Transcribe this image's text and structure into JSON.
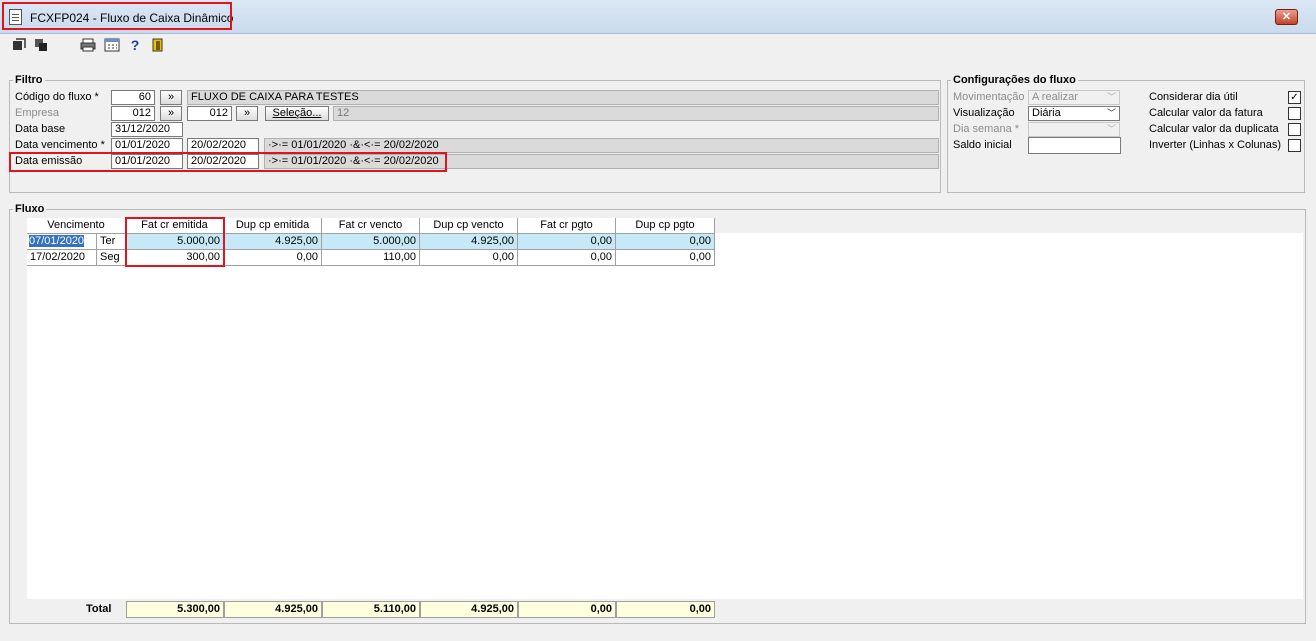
{
  "window": {
    "title": "FCXFP024 - Fluxo de Caixa Dinâmico",
    "close_label": "✕"
  },
  "toolbar": {
    "icons": [
      "arrow-in-icon",
      "copy-icon",
      "print-icon",
      "calculator-icon",
      "help-icon",
      "exit-icon"
    ]
  },
  "filtro": {
    "title": "Filtro",
    "codigo_label": "Código do fluxo *",
    "codigo_value": "60",
    "codigo_desc": "FLUXO DE CAIXA PARA TESTES",
    "empresa_label": "Empresa",
    "empresa_value": "012",
    "empresa_value2": "012",
    "selecao_label": "Seleção...",
    "selecao_count": "12",
    "lookup_label": "»",
    "data_base_label": "Data base",
    "data_base_value": "31/12/2020",
    "data_venc_label": "Data vencimento *",
    "data_venc_from": "01/01/2020",
    "data_venc_to": "20/02/2020",
    "data_venc_expr": "·>·= 01/01/2020 ·&·<·= 20/02/2020",
    "data_emis_label": "Data emissão",
    "data_emis_from": "01/01/2020",
    "data_emis_to": "20/02/2020",
    "data_emis_expr": "·>·= 01/01/2020 ·&·<·= 20/02/2020"
  },
  "config": {
    "title": "Configurações do fluxo",
    "movimentacao_label": "Movimentação",
    "movimentacao_value": "A realizar",
    "visualizacao_label": "Visualização",
    "visualizacao_value": "Diária",
    "dia_semana_label": "Dia semana *",
    "dia_semana_value": "",
    "saldo_label": "Saldo inicial",
    "saldo_value": "",
    "considerar_label": "Considerar dia útil",
    "considerar_checked": true,
    "calc_fatura_label": "Calcular valor da fatura",
    "calc_fatura_checked": false,
    "calc_duplicata_label": "Calcular valor da duplicata",
    "calc_duplicata_checked": false,
    "inverter_label": "Inverter (Linhas x Colunas)",
    "inverter_checked": false,
    "check_mark": "✓",
    "arrow": "﹀"
  },
  "fluxo": {
    "title": "Fluxo",
    "columns": [
      "Vencimento",
      "Fat cr emitida",
      "Dup cp emitida",
      "Fat cr vencto",
      "Dup cp vencto",
      "Fat cr pgto",
      "Dup cp pgto"
    ],
    "rows": [
      {
        "date": "07/01/2020",
        "day": "Ter",
        "values": [
          "5.000,00",
          "4.925,00",
          "5.000,00",
          "4.925,00",
          "0,00",
          "0,00"
        ]
      },
      {
        "date": "17/02/2020",
        "day": "Seg",
        "values": [
          "300,00",
          "0,00",
          "110,00",
          "0,00",
          "0,00",
          "0,00"
        ]
      }
    ],
    "total_label": "Total",
    "totals": [
      "5.300,00",
      "4.925,00",
      "5.110,00",
      "4.925,00",
      "0,00",
      "0,00"
    ]
  }
}
